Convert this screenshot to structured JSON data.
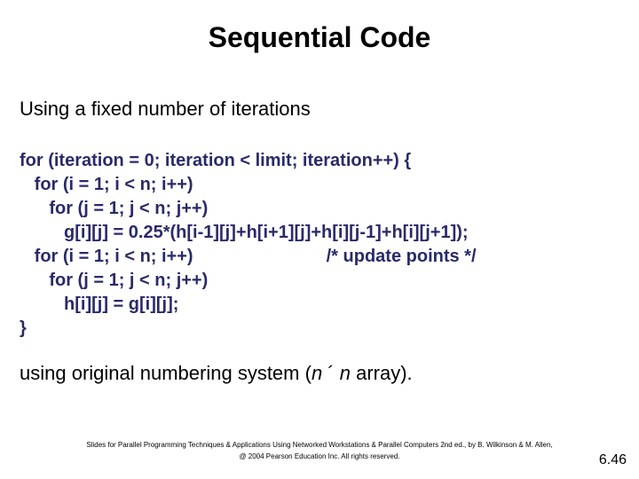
{
  "title": "Sequential Code",
  "subheading": "Using a fixed number of iterations",
  "code_lines": [
    "for (iteration = 0; iteration < limit; iteration++) {",
    "   for (i = 1; i < n; i++)",
    "      for (j = 1; j < n; j++)",
    "         g[i][j] = 0.25*(h[i-1][j]+h[i+1][j]+h[i][j-1]+h[i][j+1]);",
    "   for (i = 1; i < n; i++)                           /* update points */",
    "      for (j = 1; j < n; j++)",
    "         h[i][j] = g[i][j];",
    "}"
  ],
  "closing_pre": "using original numbering system (",
  "closing_n1": "n",
  "closing_mid": " ´ ",
  "closing_n2": "n",
  "closing_post": " array).",
  "footer_line1": "Slides for Parallel Programming Techniques & Applications Using Networked Workstations & Parallel Computers 2nd ed., by B. Wilkinson & M. Allen,",
  "footer_line2": "@ 2004 Pearson Education Inc. All rights reserved.",
  "page_number": "6.46",
  "chart_data": null
}
